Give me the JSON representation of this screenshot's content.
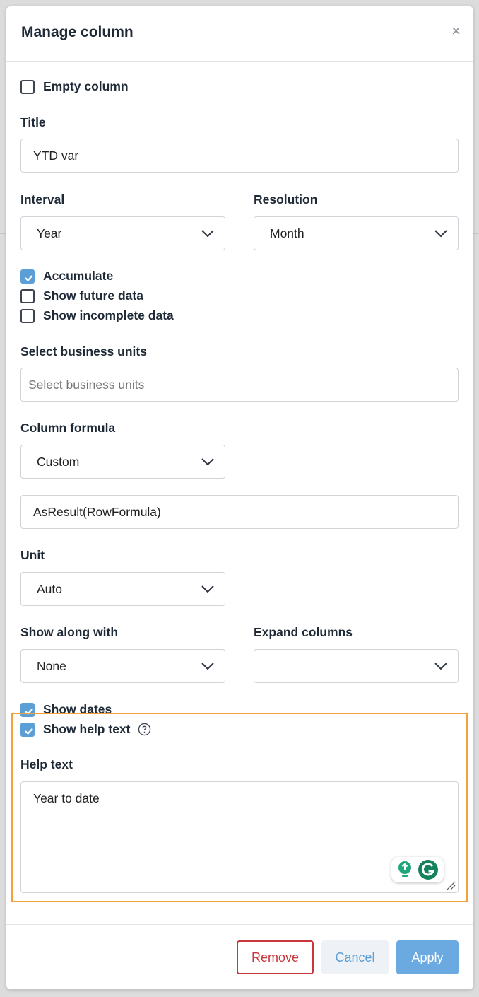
{
  "modal": {
    "title": "Manage column",
    "close_label": "×"
  },
  "empty_column": {
    "label": "Empty column",
    "checked": false
  },
  "title_field": {
    "label": "Title",
    "value": "YTD var"
  },
  "interval": {
    "label": "Interval",
    "value": "Year"
  },
  "resolution": {
    "label": "Resolution",
    "value": "Month"
  },
  "options": [
    {
      "label": "Accumulate",
      "checked": true
    },
    {
      "label": "Show future data",
      "checked": false
    },
    {
      "label": "Show incomplete data",
      "checked": false
    }
  ],
  "business_units": {
    "label": "Select business units",
    "placeholder": "Select business units"
  },
  "column_formula": {
    "label": "Column formula",
    "type_value": "Custom",
    "formula_value": "AsResult(RowFormula)"
  },
  "unit": {
    "label": "Unit",
    "value": "Auto"
  },
  "show_along_with": {
    "label": "Show along with",
    "value": "None"
  },
  "expand_columns": {
    "label": "Expand columns",
    "value": ""
  },
  "show_dates": {
    "label": "Show dates",
    "checked": true
  },
  "show_help_text": {
    "label": "Show help text",
    "checked": true
  },
  "help_text": {
    "label": "Help text",
    "value": "Year to date"
  },
  "footer": {
    "remove_label": "Remove",
    "cancel_label": "Cancel",
    "apply_label": "Apply"
  },
  "colors": {
    "accent": "#5b9fd6",
    "danger": "#c9363b",
    "highlight": "#f5a03a"
  }
}
